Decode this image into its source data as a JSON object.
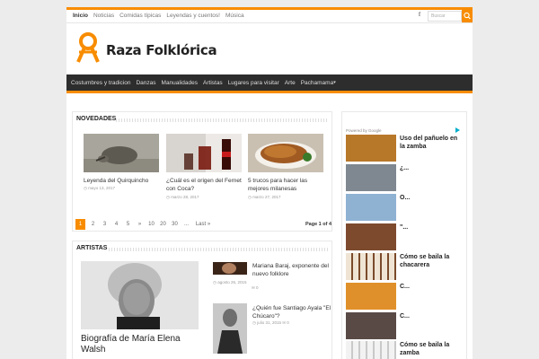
{
  "topbar": {
    "nav": [
      "Inicio",
      "Noticias",
      "Comidas típicas",
      "Leyendas y cuentos!",
      "Música"
    ],
    "facebook_glyph": "f",
    "search_placeholder": "Buscar"
  },
  "logo": {
    "text": "Raza Folklórica"
  },
  "mainnav": [
    "Costumbres y tradicion",
    "Danzas",
    "Manualidades",
    "Artistas",
    "Lugares para visitar",
    "Arte",
    "Pachamama"
  ],
  "novedades": {
    "title": "NOVEDADES",
    "cards": [
      {
        "title": "Leyenda del Quirquincho",
        "date": "mayo 13, 2017"
      },
      {
        "title": "¿Cuál es el origen del Fernet con Coca?",
        "date": "marzo 28, 2017"
      },
      {
        "title": "5 trucos para hacer las mejores milanesas",
        "date": "marzo 27, 2017"
      }
    ],
    "pager": [
      "1",
      "2",
      "3",
      "4",
      "5",
      "»",
      "10",
      "20",
      "30",
      "...",
      "Last »"
    ],
    "page_info": "Page 1 of 4"
  },
  "artistas": {
    "title": "ARTISTAS",
    "main_title": "Biografía de María Elena Walsh",
    "items": [
      {
        "title": "Mariana Baraj, exponente del nuevo folklore",
        "date": "agosto 26, 2015",
        "comments": "0"
      },
      {
        "title": "¿Quién fue Santiago Ayala \"El Chúcaro\"?",
        "date": "julio 31, 2015",
        "comments": "0"
      }
    ]
  },
  "sidebar": {
    "ad_label": "Powered by Google",
    "items": [
      "Uso del pañuelo en la zamba",
      "¿...",
      "O...",
      "\"...",
      "Cómo se baila la chacarera",
      "C...",
      "C...",
      "Cómo se baila la zamba"
    ]
  },
  "colors": {
    "accent": "#f88c00",
    "nav_bg": "#2d2d2d"
  }
}
